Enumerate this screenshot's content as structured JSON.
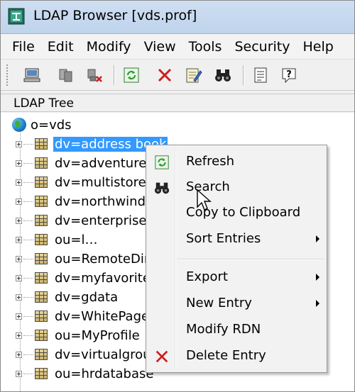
{
  "window": {
    "title": "LDAP Browser [vds.prof]"
  },
  "menubar": {
    "items": [
      "File",
      "Edit",
      "Modify",
      "View",
      "Tools",
      "Security",
      "Help"
    ]
  },
  "toolbar": {
    "buttons": [
      {
        "icon": "connect-computer-icon"
      },
      {
        "icon": "disconnect-servers-icon"
      },
      {
        "icon": "remove-connection-icon"
      },
      {
        "icon": "refresh-icon"
      },
      {
        "icon": "delete-icon"
      },
      {
        "icon": "edit-icon"
      },
      {
        "icon": "search-binoculars-icon"
      },
      {
        "icon": "document-icon"
      },
      {
        "icon": "help-icon"
      }
    ]
  },
  "tree": {
    "header": "LDAP Tree",
    "root": "o=vds",
    "nodes": [
      "dv=address book",
      "dv=adventure",
      "dv=multistore",
      "dv=northwind",
      "dv=enterprised",
      "ou=l…",
      "ou=RemoteDire",
      "dv=myfavorite",
      "dv=gdata",
      "dv=WhitePage",
      "ou=MyProfile",
      "dv=virtualgrou",
      "ou=hrdatabase"
    ],
    "selected_index": 0
  },
  "context_menu": {
    "items": [
      {
        "label": "Refresh",
        "icon": "refresh-icon"
      },
      {
        "label": "Search",
        "icon": "binoculars-icon"
      },
      {
        "label": "Copy to Clipboard"
      },
      {
        "label": "Sort Entries",
        "submenu": true
      },
      {
        "label": "Export",
        "submenu": true
      },
      {
        "label": "New Entry",
        "submenu": true
      },
      {
        "label": "Modify RDN"
      },
      {
        "label": "Delete Entry",
        "icon": "delete-x-icon"
      }
    ]
  },
  "colors": {
    "selection": "#3399ff",
    "delete_red": "#cc1f1f",
    "refresh_green": "#2e9b2e"
  }
}
